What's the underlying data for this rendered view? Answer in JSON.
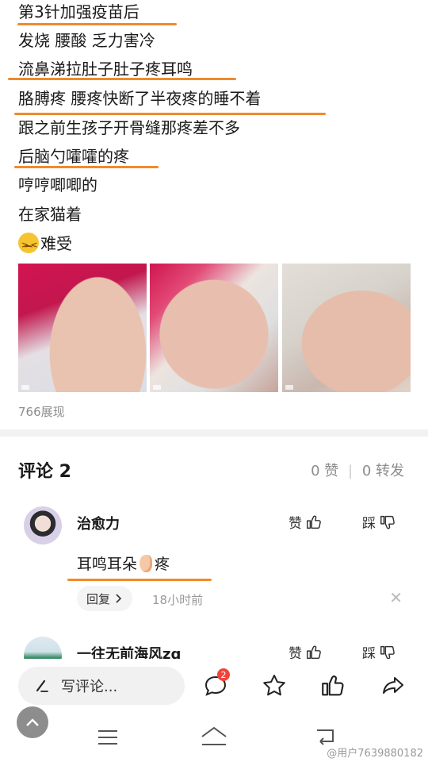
{
  "post": {
    "lines": [
      "第3针加强疫苗后",
      "发烧 腰酸 乏力害冷",
      "流鼻涕拉肚子肚子疼耳鸣",
      "胳膊疼 腰疼快断了半夜疼的睡不着",
      "跟之前生孩子开骨缝那疼差不多",
      "后脑勺嚯嚯的疼",
      "哼哼唧唧的",
      "在家猫着",
      "难受"
    ],
    "emoji_icon": "persevering-face-emoji",
    "views": "766展现",
    "underline_color": "#f08a2c"
  },
  "comments_header": {
    "title": "评论 2",
    "likes": "0 赞",
    "separator": "|",
    "reposts": "0 转发"
  },
  "comments": [
    {
      "user": "治愈力",
      "like_label": "赞",
      "dislike_label": "踩",
      "text_before": "耳鸣耳朵",
      "text_after": "疼",
      "reply_label": "回复",
      "time": "18小时前"
    },
    {
      "user": "一往无前海风zq",
      "like_label": "赞",
      "dislike_label": "踩"
    }
  ],
  "bottom_bar": {
    "comment_placeholder": "写评论...",
    "message_badge": "2"
  },
  "watermark": "@用户7639880182"
}
